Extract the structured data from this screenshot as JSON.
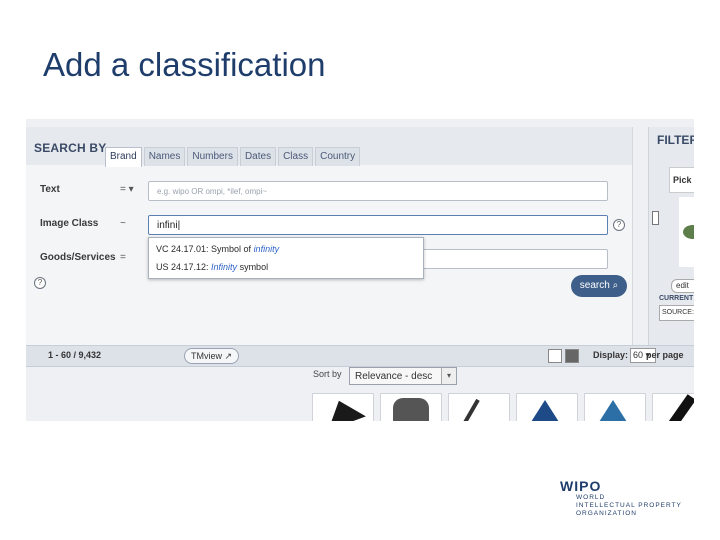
{
  "slide": {
    "title": "Add a classification"
  },
  "search_panel": {
    "heading": "SEARCH BY",
    "tabs": [
      "Brand",
      "Names",
      "Numbers",
      "Dates",
      "Class",
      "Country"
    ],
    "active_tab": "Brand",
    "rows": {
      "text": {
        "label": "Text",
        "operator": "= ▾",
        "placeholder": "e.g. wipo OR ompi, *ilef, ompi~"
      },
      "image_class": {
        "label": "Image Class",
        "operator": "~",
        "value": "infini|"
      },
      "goods_services": {
        "label": "Goods/Services",
        "operator": "="
      }
    },
    "suggestions": [
      {
        "prefix": "VC 24.17.01: Symbol of ",
        "match": "infinity",
        "suffix": ""
      },
      {
        "prefix": "US 24.17.12: ",
        "match": "Infinity",
        "suffix": " symbol"
      }
    ],
    "search_button": "search ⌕",
    "help_glyph": "?"
  },
  "results_bar": {
    "count": "1 - 60 / 9,432",
    "tmview_label": "TMview ↗",
    "display_label": "Display:",
    "display_value": "60 ▾",
    "per_page": "per page"
  },
  "sort": {
    "label": "Sort by",
    "value": "Relevance - desc",
    "caret": "▾"
  },
  "filter_panel": {
    "heading": "FILTER",
    "pick_label": "Pick a",
    "edit_label": "edit",
    "current_label": "CURRENT",
    "source_label": "SOURCE:"
  },
  "logo": {
    "mark": "WIPO",
    "lines": [
      "WORLD",
      "INTELLECTUAL PROPERTY",
      "ORGANIZATION"
    ]
  },
  "colors": {
    "title": "#1f3d6b",
    "accent": "#3e5f8a",
    "highlight": "#2e62c7"
  }
}
